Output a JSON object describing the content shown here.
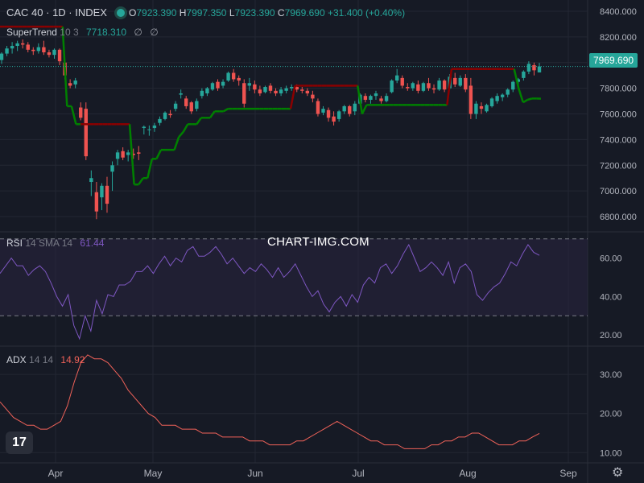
{
  "header": {
    "symbol": "CAC 40 · 1D · INDEX",
    "open_label": "O",
    "open": "7923.390",
    "high_label": "H",
    "high": "7997.350",
    "low_label": "L",
    "low": "7923.390",
    "close_label": "C",
    "close": "7969.690",
    "change": "+31.400 (+0.40%)",
    "status_color": "#26a69a"
  },
  "supertrend": {
    "name": "SuperTrend",
    "params": "10 3",
    "value": "7718.310",
    "icons": [
      "∅",
      "∅"
    ]
  },
  "rsi": {
    "name": "RSI",
    "params": "14 SMA 14",
    "value": "61.44"
  },
  "adx": {
    "name": "ADX",
    "params": "14 14",
    "value": "14.92"
  },
  "watermark": "CHART-IMG.COM",
  "last_price": "7969.690",
  "logo": "17",
  "settings_icon": "gear-icon",
  "colors": {
    "background": "#161a25",
    "up": "#26a69a",
    "down": "#ef5350",
    "supertrend_up": "#008000",
    "supertrend_down": "#8b0000",
    "rsi_line": "#7e57c2",
    "rsi_band": "#2a2540",
    "adx_line": "#f06259"
  },
  "chart_data": [
    {
      "type": "candlestick",
      "title": "CAC 40 · 1D · INDEX",
      "y_ticks": [
        8400,
        8200,
        8000,
        7800,
        7600,
        7400,
        7200,
        7000,
        6800
      ],
      "ylim": [
        6700,
        8450
      ],
      "x_tick_labels": [
        "Apr",
        "May",
        "Jun",
        "Jul",
        "Aug",
        "Sep"
      ],
      "last_price": 7969.69,
      "series": [
        {
          "name": "CAC 40",
          "ohlc": [
            [
              8020,
              8080,
              7990,
              8070
            ],
            [
              8070,
              8130,
              8050,
              8110
            ],
            [
              8110,
              8160,
              8070,
              8130
            ],
            [
              8130,
              8170,
              8090,
              8150
            ],
            [
              8150,
              8180,
              8110,
              8140
            ],
            [
              8140,
              8160,
              8080,
              8100
            ],
            [
              8100,
              8120,
              8060,
              8090
            ],
            [
              8090,
              8150,
              8070,
              8120
            ],
            [
              8120,
              8170,
              8060,
              8080
            ],
            [
              8080,
              8100,
              8040,
              8060
            ],
            [
              8060,
              8110,
              8030,
              8100
            ],
            [
              8100,
              8110,
              7980,
              8010
            ],
            [
              8000,
              8010,
              7870,
              7900
            ],
            [
              7840,
              7870,
              7800,
              7820
            ],
            [
              7830,
              7880,
              7800,
              7860
            ],
            [
              7650,
              7690,
              7550,
              7570
            ],
            [
              7640,
              7690,
              7240,
              7270
            ],
            [
              7070,
              7160,
              6960,
              7100
            ],
            [
              6990,
              7070,
              6780,
              6840
            ],
            [
              6950,
              7060,
              6850,
              7040
            ],
            [
              7040,
              7110,
              6830,
              6900
            ],
            [
              7150,
              7230,
              7000,
              7200
            ],
            [
              7250,
              7320,
              7200,
              7300
            ],
            [
              7310,
              7340,
              7240,
              7260
            ],
            [
              7280,
              7320,
              7230,
              7300
            ],
            [
              7290,
              7330,
              7250,
              7280
            ],
            [
              7300,
              7350,
              7240,
              7290
            ],
            [
              7490,
              7510,
              7440,
              7500
            ],
            [
              7480,
              7510,
              7430,
              7480
            ],
            [
              7490,
              7530,
              7460,
              7510
            ],
            [
              7530,
              7580,
              7510,
              7560
            ],
            [
              7560,
              7620,
              7550,
              7610
            ],
            [
              7600,
              7630,
              7570,
              7590
            ],
            [
              7640,
              7700,
              7620,
              7680
            ],
            [
              7750,
              7790,
              7720,
              7760
            ],
            [
              7720,
              7740,
              7640,
              7660
            ],
            [
              7690,
              7700,
              7600,
              7620
            ],
            [
              7640,
              7720,
              7620,
              7700
            ],
            [
              7740,
              7800,
              7720,
              7780
            ],
            [
              7760,
              7810,
              7740,
              7800
            ],
            [
              7790,
              7850,
              7780,
              7840
            ],
            [
              7850,
              7870,
              7780,
              7800
            ],
            [
              7820,
              7870,
              7800,
              7850
            ],
            [
              7860,
              7930,
              7850,
              7920
            ],
            [
              7920,
              7950,
              7850,
              7870
            ],
            [
              7880,
              7900,
              7820,
              7860
            ],
            [
              7840,
              7870,
              7650,
              7680
            ],
            [
              7820,
              7880,
              7780,
              7840
            ],
            [
              7830,
              7860,
              7760,
              7790
            ],
            [
              7790,
              7820,
              7740,
              7760
            ],
            [
              7770,
              7820,
              7760,
              7810
            ],
            [
              7820,
              7840,
              7760,
              7780
            ],
            [
              7780,
              7800,
              7740,
              7760
            ],
            [
              7760,
              7810,
              7740,
              7790
            ],
            [
              7780,
              7820,
              7760,
              7800
            ],
            [
              7800,
              7830,
              7780,
              7810
            ],
            [
              7810,
              7830,
              7770,
              7790
            ],
            [
              7790,
              7810,
              7760,
              7780
            ],
            [
              7780,
              7800,
              7740,
              7760
            ],
            [
              7750,
              7780,
              7690,
              7720
            ],
            [
              7700,
              7720,
              7580,
              7600
            ],
            [
              7610,
              7660,
              7590,
              7640
            ],
            [
              7630,
              7650,
              7540,
              7570
            ],
            [
              7580,
              7620,
              7510,
              7540
            ],
            [
              7560,
              7630,
              7540,
              7620
            ],
            [
              7620,
              7670,
              7600,
              7660
            ],
            [
              7660,
              7670,
              7580,
              7600
            ],
            [
              7620,
              7700,
              7590,
              7680
            ],
            [
              7680,
              7760,
              7670,
              7750
            ],
            [
              7740,
              7760,
              7690,
              7710
            ],
            [
              7710,
              7750,
              7680,
              7740
            ],
            [
              7740,
              7780,
              7710,
              7760
            ],
            [
              7720,
              7740,
              7680,
              7700
            ],
            [
              7700,
              7760,
              7690,
              7740
            ],
            [
              7770,
              7870,
              7760,
              7860
            ],
            [
              7860,
              7950,
              7840,
              7900
            ],
            [
              7880,
              7900,
              7800,
              7820
            ],
            [
              7810,
              7840,
              7780,
              7800
            ],
            [
              7800,
              7850,
              7780,
              7840
            ],
            [
              7830,
              7860,
              7760,
              7780
            ],
            [
              7780,
              7850,
              7770,
              7840
            ],
            [
              7840,
              7880,
              7780,
              7800
            ],
            [
              7800,
              7830,
              7760,
              7790
            ],
            [
              7790,
              7880,
              7780,
              7860
            ],
            [
              7860,
              7870,
              7770,
              7790
            ],
            [
              7800,
              7910,
              7790,
              7890
            ],
            [
              7880,
              7920,
              7810,
              7830
            ],
            [
              7820,
              7900,
              7810,
              7880
            ],
            [
              7880,
              7910,
              7770,
              7790
            ],
            [
              7820,
              7880,
              7560,
              7600
            ],
            [
              7600,
              7700,
              7560,
              7680
            ],
            [
              7660,
              7690,
              7600,
              7640
            ],
            [
              7620,
              7680,
              7610,
              7670
            ],
            [
              7660,
              7730,
              7650,
              7720
            ],
            [
              7700,
              7760,
              7680,
              7740
            ],
            [
              7730,
              7760,
              7700,
              7750
            ],
            [
              7750,
              7800,
              7730,
              7790
            ],
            [
              7790,
              7860,
              7770,
              7850
            ],
            [
              7850,
              7880,
              7820,
              7870
            ],
            [
              7880,
              7940,
              7860,
              7930
            ],
            [
              7930,
              8010,
              7910,
              7990
            ],
            [
              7980,
              8000,
              7900,
              7940
            ],
            [
              7923.39,
              7997.35,
              7923.39,
              7969.69
            ]
          ]
        },
        {
          "name": "SuperTrend",
          "values": [
            8280,
            8280,
            8280,
            8280,
            8280,
            8280,
            8280,
            8280,
            8280,
            8280,
            8280,
            8280,
            8280,
            8280,
            8280,
            7660,
            7660,
            7520,
            7520,
            7520,
            7520,
            7520,
            7520,
            7520,
            7520,
            7520,
            7520,
            7520,
            7520,
            7520,
            7050,
            7050,
            7100,
            7100,
            7250,
            7250,
            7320,
            7320,
            7320,
            7320,
            7420,
            7460,
            7520,
            7520,
            7520,
            7570,
            7570,
            7570,
            7620,
            7620,
            7620,
            7640,
            7640,
            7640,
            7640,
            7640,
            7640,
            7640,
            7640,
            7640,
            7640,
            7640,
            7640,
            7640,
            7640,
            7640,
            7820,
            7820,
            7820,
            7820,
            7820,
            7820,
            7820,
            7820,
            7820,
            7820,
            7820,
            7820,
            7820,
            7820,
            7820,
            7600,
            7670,
            7670,
            7670,
            7670,
            7670,
            7670,
            7670,
            7670,
            7670,
            7670,
            7670,
            7670,
            7670,
            7670,
            7670,
            7670,
            7670,
            7670,
            7670,
            7950,
            7950,
            7950,
            7950,
            7950,
            7950,
            7950,
            7950,
            7950,
            7950,
            7950,
            7950,
            7950,
            7950,
            7950,
            7800,
            7690,
            7710,
            7720,
            7720,
            7718.31
          ]
        }
      ]
    },
    {
      "type": "line",
      "title": "RSI 14 SMA 14",
      "y_ticks": [
        60,
        40,
        20
      ],
      "ylim": [
        15,
        72
      ],
      "bands": [
        30,
        70
      ],
      "series": [
        {
          "name": "RSI",
          "values": [
            52,
            56,
            60,
            56,
            56,
            51,
            54,
            56,
            53,
            47,
            40,
            35,
            41,
            25,
            18,
            30,
            22,
            38,
            31,
            41,
            40,
            46,
            46,
            48,
            53,
            53,
            56,
            52,
            57,
            61,
            56,
            60,
            58,
            64,
            66,
            61,
            61,
            63,
            66,
            62,
            57,
            60,
            56,
            52,
            55,
            53,
            57,
            54,
            50,
            55,
            50,
            53,
            57,
            51,
            45,
            40,
            43,
            36,
            32,
            37,
            40,
            35,
            41,
            37,
            46,
            50,
            47,
            55,
            57,
            52,
            56,
            62,
            67,
            60,
            53,
            55,
            58,
            55,
            51,
            58,
            47,
            55,
            57,
            53,
            41,
            38,
            42,
            45,
            47,
            52,
            58,
            56,
            62,
            67,
            63,
            61.44
          ]
        }
      ]
    },
    {
      "type": "line",
      "title": "ADX 14 14",
      "y_ticks": [
        30,
        20,
        10
      ],
      "ylim": [
        8,
        36
      ],
      "series": [
        {
          "name": "ADX",
          "values": [
            23,
            21,
            19,
            18,
            17,
            17,
            16,
            16,
            17,
            18,
            22,
            28,
            33,
            35,
            34,
            34,
            33,
            31,
            29,
            26,
            24,
            22,
            20,
            19,
            17,
            17,
            17,
            16,
            16,
            16,
            15,
            15,
            15,
            14,
            14,
            14,
            14,
            13,
            13,
            13,
            12,
            12,
            12,
            12,
            13,
            13,
            14,
            15,
            16,
            17,
            18,
            17,
            16,
            15,
            14,
            13,
            13,
            12,
            12,
            12,
            11,
            11,
            11,
            11,
            12,
            12,
            13,
            13,
            14,
            14,
            15,
            15,
            14,
            13,
            12,
            12,
            12,
            13,
            13,
            14,
            14.92
          ]
        }
      ]
    }
  ]
}
